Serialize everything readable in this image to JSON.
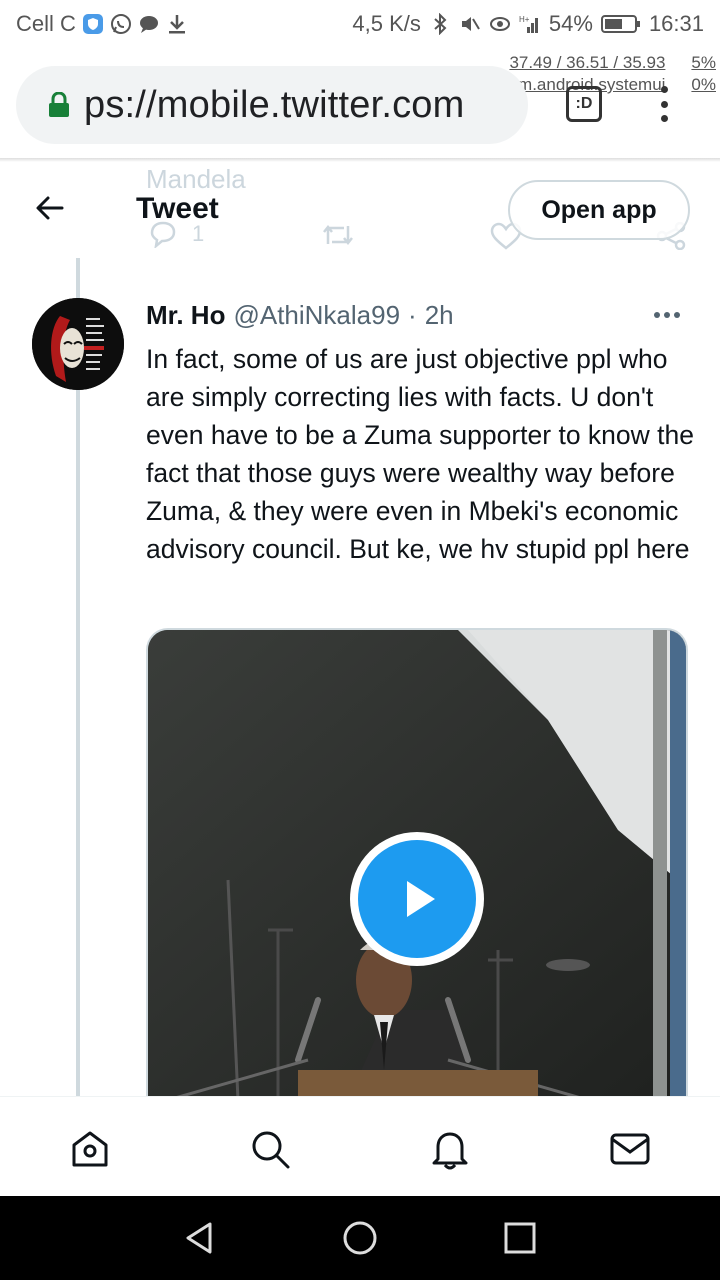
{
  "status_bar": {
    "carrier": "Cell C",
    "speed": "4,5 K/s",
    "signal_label": "H+",
    "battery": "54%",
    "time": "16:31",
    "overlay_line1": "37.49 / 36.51 / 35.93",
    "overlay_line1_pct": "5%",
    "overlay_line2": "com.android.systemui",
    "overlay_line2_pct": "0%"
  },
  "browser": {
    "url": "ps://mobile.twitter.com",
    "tab_button_label": ":D"
  },
  "header": {
    "title": "Tweet",
    "open_app_label": "Open app",
    "ghost_name": "Mandela",
    "ghost_reply_count": "1"
  },
  "tweet": {
    "name": "Mr. Ho",
    "handle": "@AthiNkala99",
    "separator": "·",
    "time": "2h",
    "text": "In fact, some of us are just objective ppl who are simply correcting lies with facts. U don't even have to be a Zuma supporter to know the fact that those guys were wealthy way before Zuma, & they were even in Mbeki's economic advisory council. But ke, we hv stupid ppl here"
  },
  "icons": {
    "back": "back-arrow-icon",
    "play": "play-icon",
    "home": "home-icon",
    "search": "search-icon",
    "notifications": "bell-icon",
    "messages": "mail-icon"
  },
  "colors": {
    "accent": "#1d9bf0",
    "secure_lock": "#188038",
    "border": "#cfd9de"
  }
}
